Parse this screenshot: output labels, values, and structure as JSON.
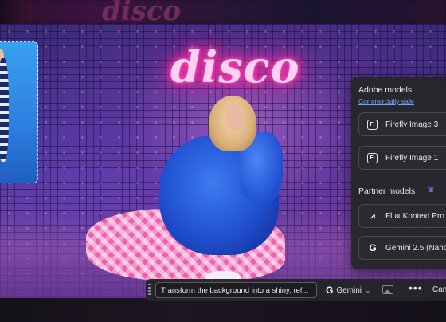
{
  "image": {
    "neon_text": "disco",
    "ghost_text": "disco"
  },
  "model_panel": {
    "adobe_title": "Adobe models",
    "commercially_safe": "Commercially safe",
    "adobe_models": [
      {
        "label": "Firefly Image 3",
        "icon": "firefly-icon"
      },
      {
        "label": "Firefly Image 1",
        "icon": "firefly-icon"
      }
    ],
    "partner_title": "Partner models",
    "partner_models": [
      {
        "label": "Flux Kontext Pro",
        "icon": "flux-icon"
      },
      {
        "label": "Gemini 2.5 (Nano",
        "icon": "google-icon"
      }
    ]
  },
  "toolbar": {
    "prompt_value": "Transform the background into a shiny, ref...",
    "model_label": "Gemini",
    "more_glyph": "•••",
    "cancel_label": "Can"
  },
  "colors": {
    "panel_bg": "#26262a",
    "link": "#6fa8ff",
    "neon": "#ff3aa8",
    "crown": "#9b7dff"
  }
}
